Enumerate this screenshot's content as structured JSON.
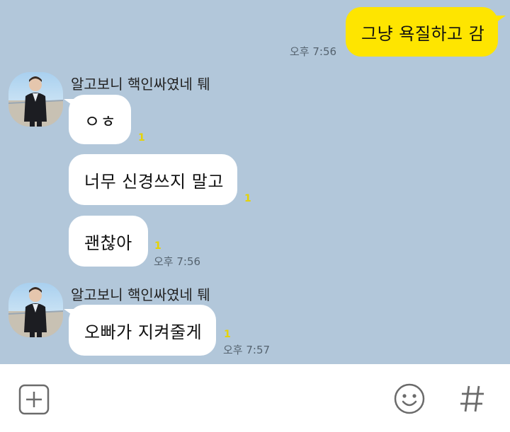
{
  "messages": {
    "m1": {
      "text": "그냥 욕질하고 감",
      "time": "오후 7:56"
    },
    "group1": {
      "sender": "알고보니 핵인싸였네 퉤",
      "m2": {
        "text": "ㅇㅎ",
        "unread": "1"
      },
      "m3": {
        "text": "너무 신경쓰지 말고",
        "unread": "1"
      },
      "m4": {
        "text": "괜찮아",
        "unread": "1",
        "time": "오후 7:56"
      }
    },
    "group2": {
      "sender": "알고보니 핵인싸였네 퉤",
      "m5": {
        "text": "오빠가 지켜줄게",
        "unread": "1",
        "time": "오후 7:57"
      }
    }
  },
  "toolbar": {
    "attach_icon": "plus-box-icon",
    "emoji_icon": "smiley-icon",
    "hash_icon": "hash-icon"
  },
  "colors": {
    "background": "#b2c7da",
    "outgoing_bubble": "#fee500",
    "incoming_bubble": "#ffffff",
    "unread": "#e6d300"
  }
}
